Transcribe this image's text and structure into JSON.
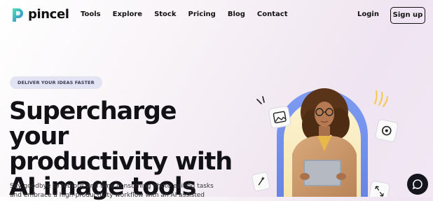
{
  "brand": {
    "name": "pincel",
    "logo_colors": [
      "#3ecfa8",
      "#2a8fd6"
    ]
  },
  "nav": {
    "links": [
      {
        "label": "Tools"
      },
      {
        "label": "Explore"
      },
      {
        "label": "Stock"
      },
      {
        "label": "Pricing"
      },
      {
        "label": "Blog"
      },
      {
        "label": "Contact"
      }
    ],
    "login_label": "Login",
    "signup_label": "Sign up"
  },
  "hero": {
    "badge": "DELIVER YOUR IDEAS FASTER",
    "headline_lines": [
      "Supercharge your",
      "productivity with",
      "AI image tools"
    ],
    "subtext_lines": [
      "Say goodbye to tedious and time consuming photo editing tasks",
      "and embrace a high-productivity workflow with an AI assisted"
    ]
  },
  "illustration": {
    "floating_icons": [
      "image-icon",
      "settings-icon",
      "sparkle-wand-icon",
      "expand-arrows-icon"
    ]
  },
  "chat": {
    "icon": "chat-bubble-icon"
  },
  "colors": {
    "text": "#121216",
    "badge_bg": "#e3e4f3",
    "accent_blue": "#5b7be8",
    "accent_yellow": "#f5c84a"
  }
}
